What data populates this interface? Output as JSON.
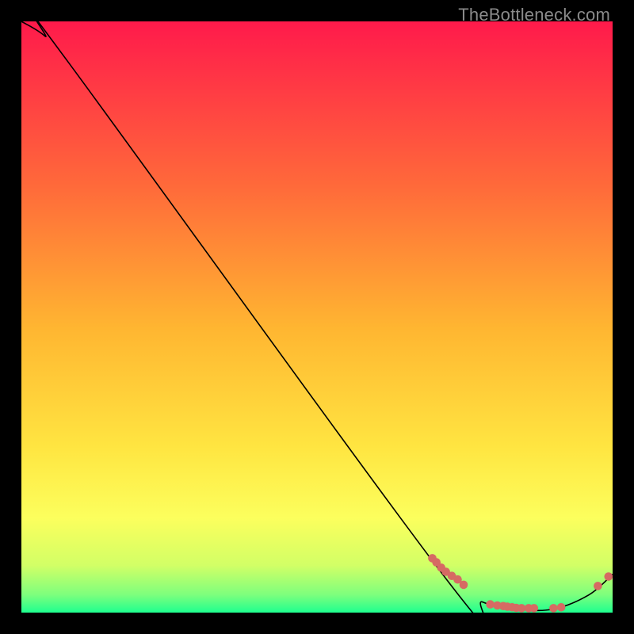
{
  "watermark": "TheBottleneck.com",
  "colors": {
    "bg": "#000000",
    "grad_top": "#ff1a4b",
    "grad_mid1": "#ff6a3a",
    "grad_mid2": "#ffb631",
    "grad_mid3": "#ffe541",
    "grad_mid4": "#fcff5d",
    "grad_bot1": "#d2ff66",
    "grad_bot2": "#7dff7d",
    "grad_bot3": "#1eff8f",
    "curve": "#000000",
    "marker": "#d66a63"
  },
  "chart_data": {
    "type": "line",
    "title": "",
    "xlabel": "",
    "ylabel": "",
    "xlim": [
      0,
      100
    ],
    "ylim": [
      0,
      100
    ],
    "curve": [
      {
        "x": 0,
        "y": 100
      },
      {
        "x": 4,
        "y": 97.5
      },
      {
        "x": 8,
        "y": 93
      },
      {
        "x": 72,
        "y": 5.5
      },
      {
        "x": 78,
        "y": 1.8
      },
      {
        "x": 84,
        "y": 0.6
      },
      {
        "x": 90,
        "y": 0.6
      },
      {
        "x": 96,
        "y": 3
      },
      {
        "x": 100,
        "y": 6.5
      }
    ],
    "markers": [
      {
        "x": 69.5,
        "y": 9.2
      },
      {
        "x": 70.2,
        "y": 8.5
      },
      {
        "x": 71.0,
        "y": 7.6
      },
      {
        "x": 71.8,
        "y": 6.9
      },
      {
        "x": 72.8,
        "y": 6.2
      },
      {
        "x": 73.8,
        "y": 5.6
      },
      {
        "x": 74.8,
        "y": 4.7
      },
      {
        "x": 79.3,
        "y": 1.4
      },
      {
        "x": 80.5,
        "y": 1.2
      },
      {
        "x": 81.5,
        "y": 1.1
      },
      {
        "x": 82.2,
        "y": 1.0
      },
      {
        "x": 83.0,
        "y": 0.9
      },
      {
        "x": 83.7,
        "y": 0.8
      },
      {
        "x": 84.6,
        "y": 0.75
      },
      {
        "x": 85.8,
        "y": 0.75
      },
      {
        "x": 86.7,
        "y": 0.75
      },
      {
        "x": 90.0,
        "y": 0.75
      },
      {
        "x": 91.3,
        "y": 0.9
      },
      {
        "x": 97.5,
        "y": 4.5
      },
      {
        "x": 99.3,
        "y": 6.1
      }
    ]
  }
}
